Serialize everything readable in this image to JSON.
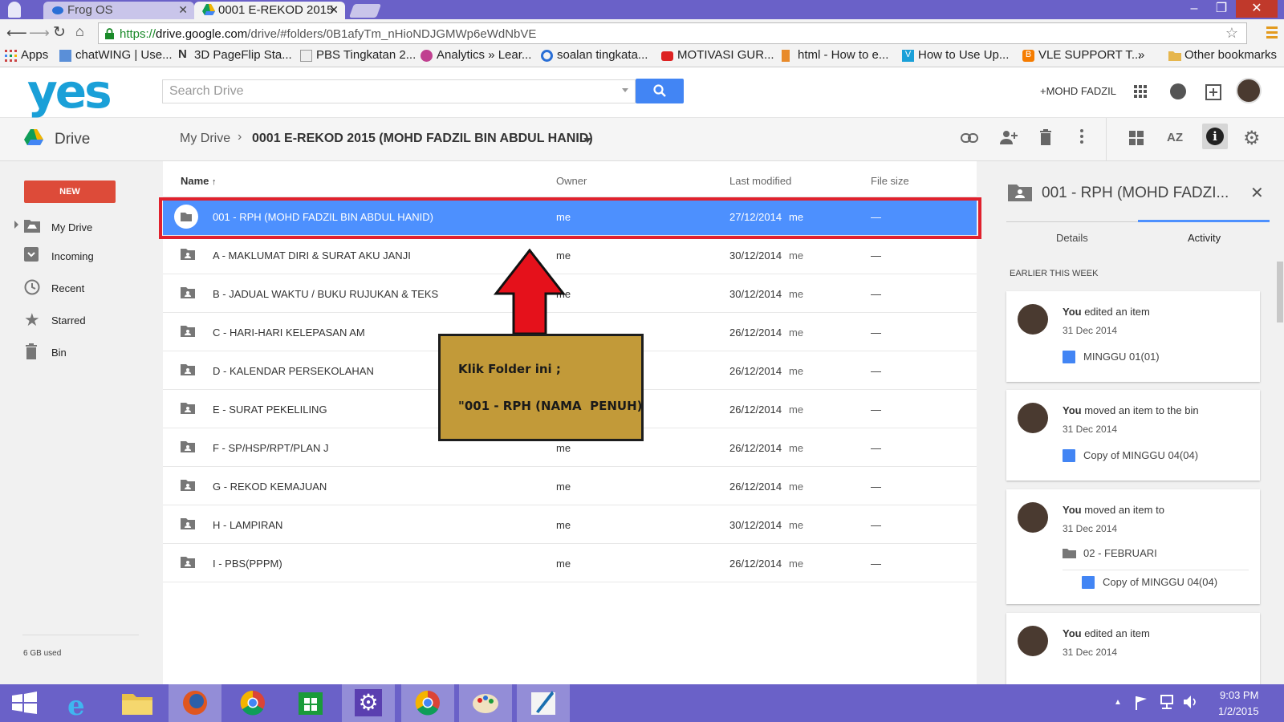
{
  "browser": {
    "tabs": [
      {
        "label": "Frog OS",
        "active": false
      },
      {
        "label": "0001 E-REKOD 2015",
        "active": true
      }
    ],
    "url_scheme": "https://",
    "url_host": "drive.google.com",
    "url_path": "/drive/#folders/0B1afyTm_nHioNDJGMWp6eWdNbVE",
    "bookmarks": [
      {
        "label": "Apps",
        "icon": "apps-grid-icon"
      },
      {
        "label": "chatWING | Use...",
        "icon": "chatwing-icon"
      },
      {
        "label": "3D PageFlip Sta...",
        "icon": "n-icon"
      },
      {
        "label": "PBS Tingkatan 2...",
        "icon": "page-icon"
      },
      {
        "label": "Analytics » Lear...",
        "icon": "analytics-icon"
      },
      {
        "label": "soalan tingkata...",
        "icon": "blue-swirl-icon"
      },
      {
        "label": "MOTIVASI GUR...",
        "icon": "youtube-icon"
      },
      {
        "label": "html - How to e...",
        "icon": "stackoverflow-icon"
      },
      {
        "label": "How to Use Up...",
        "icon": "vimeo-icon"
      },
      {
        "label": "VLE SUPPORT T...",
        "icon": "blogger-icon"
      },
      {
        "label": "»",
        "icon": ""
      },
      {
        "label": "Other bookmarks",
        "icon": "folder-icon"
      }
    ]
  },
  "header": {
    "logo": "yes",
    "search_placeholder": "Search Drive",
    "user_link": "+MOHD FADZIL"
  },
  "drivebar": {
    "app_name": "Drive",
    "breadcrumb_root": "My Drive",
    "breadcrumb_current": "0001 E-REKOD 2015 (MOHD FADZIL BIN ABDUL HANID)",
    "sort_label": "AZ"
  },
  "sidebar": {
    "new_label": "NEW",
    "items": [
      {
        "label": "My Drive",
        "icon": "my-drive-icon"
      },
      {
        "label": "Incoming",
        "icon": "incoming-icon"
      },
      {
        "label": "Recent",
        "icon": "clock-icon"
      },
      {
        "label": "Starred",
        "icon": "star-icon"
      },
      {
        "label": "Bin",
        "icon": "trash-icon"
      }
    ],
    "storage": "6 GB used"
  },
  "list": {
    "columns": {
      "name": "Name",
      "sort_arrow": "↑",
      "owner": "Owner",
      "modified": "Last modified",
      "size": "File size"
    },
    "rows": [
      {
        "name": "001 - RPH (MOHD FADZIL BIN ABDUL HANID)",
        "owner": "me",
        "modified": "27/12/2014",
        "by": "me",
        "size": "—",
        "selected": true
      },
      {
        "name": "A - MAKLUMAT DIRI & SURAT AKU JANJI",
        "owner": "me",
        "modified": "30/12/2014",
        "by": "me",
        "size": "—"
      },
      {
        "name": "B - JADUAL WAKTU / BUKU RUJUKAN & TEKS",
        "owner": "me",
        "modified": "30/12/2014",
        "by": "me",
        "size": "—"
      },
      {
        "name": "C - HARI-HARI KELEPASAN AM",
        "owner": "",
        "modified": "26/12/2014",
        "by": "me",
        "size": "—"
      },
      {
        "name": "D - KALENDAR PERSEKOLAHAN",
        "owner": "",
        "modified": "26/12/2014",
        "by": "me",
        "size": "—"
      },
      {
        "name": "E - SURAT PEKELILING",
        "owner": "",
        "modified": "26/12/2014",
        "by": "me",
        "size": "—"
      },
      {
        "name": "F - SP/HSP/RPT/PLAN J",
        "owner": "me",
        "modified": "26/12/2014",
        "by": "me",
        "size": "—"
      },
      {
        "name": "G - REKOD KEMAJUAN",
        "owner": "me",
        "modified": "26/12/2014",
        "by": "me",
        "size": "—"
      },
      {
        "name": "H - LAMPIRAN",
        "owner": "me",
        "modified": "30/12/2014",
        "by": "me",
        "size": "—"
      },
      {
        "name": "I - PBS(PPPM)",
        "owner": "me",
        "modified": "26/12/2014",
        "by": "me",
        "size": "—"
      }
    ]
  },
  "callout": {
    "line1": "Klik Folder ini ;",
    "line2": "\"001 - RPH (NAMA  PENUH)"
  },
  "details_panel": {
    "title": "001 - RPH (MOHD FADZI...",
    "tab_details": "Details",
    "tab_activity": "Activity",
    "section": "EARLIER THIS WEEK",
    "activities": [
      {
        "actor": "You",
        "action": " edited an item",
        "date": "31 Dec 2014",
        "items": [
          {
            "label": "MINGGU 01(01)",
            "icon": "doc-icon"
          }
        ]
      },
      {
        "actor": "You",
        "action": " moved an item to the bin",
        "date": "31 Dec 2014",
        "items": [
          {
            "label": "Copy of MINGGU 04(04)",
            "icon": "doc-icon"
          }
        ]
      },
      {
        "actor": "You",
        "action": " moved an item to",
        "date": "31 Dec 2014",
        "items": [
          {
            "label": "02 - FEBRUARI",
            "icon": "folder-icon"
          },
          {
            "label": "Copy of MINGGU 04(04)",
            "icon": "doc-icon"
          }
        ]
      },
      {
        "actor": "You",
        "action": " edited an item",
        "date": "31 Dec 2014",
        "items": []
      }
    ]
  },
  "taskbar": {
    "apps": [
      "start-icon",
      "ie-icon",
      "file-explorer-icon",
      "firefox-icon",
      "chrome-icon",
      "store-icon",
      "settings-icon",
      "chrome-active-icon",
      "paint-icon",
      "quill-icon"
    ],
    "time": "9:03 PM",
    "date": "1/2/2015"
  },
  "colors": {
    "accent_blue": "#4d90fe",
    "new_button": "#dd4b39",
    "highlight_red": "#e0212d",
    "callout_bg": "#c29a39",
    "taskbar": "#6a61c8"
  }
}
